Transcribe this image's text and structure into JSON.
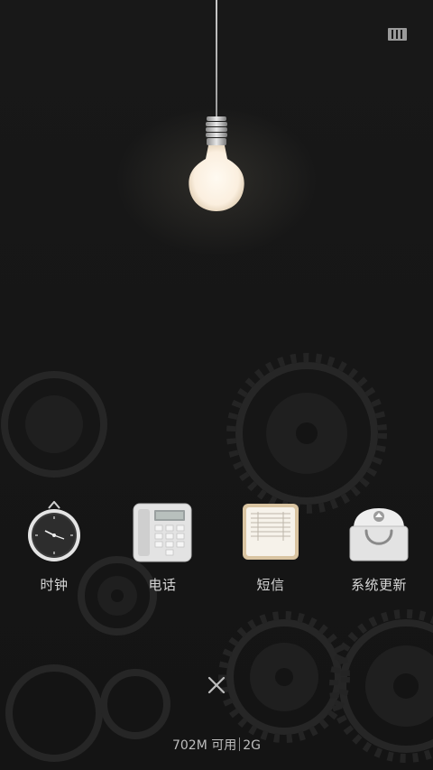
{
  "apps": [
    {
      "label": "时钟",
      "icon": "clock-icon"
    },
    {
      "label": "电话",
      "icon": "phone-icon"
    },
    {
      "label": "短信",
      "icon": "messages-icon"
    },
    {
      "label": "系统更新",
      "icon": "system-update-icon"
    }
  ],
  "memory": {
    "available": "702M 可用",
    "used": "2G"
  },
  "icons": {
    "close": "close-icon",
    "toggle": "bar-icon",
    "bulb": "light-bulb"
  },
  "colors": {
    "background": "#161616",
    "bulb_glow": "#fdf2e3",
    "label": "#d6d6d6"
  }
}
